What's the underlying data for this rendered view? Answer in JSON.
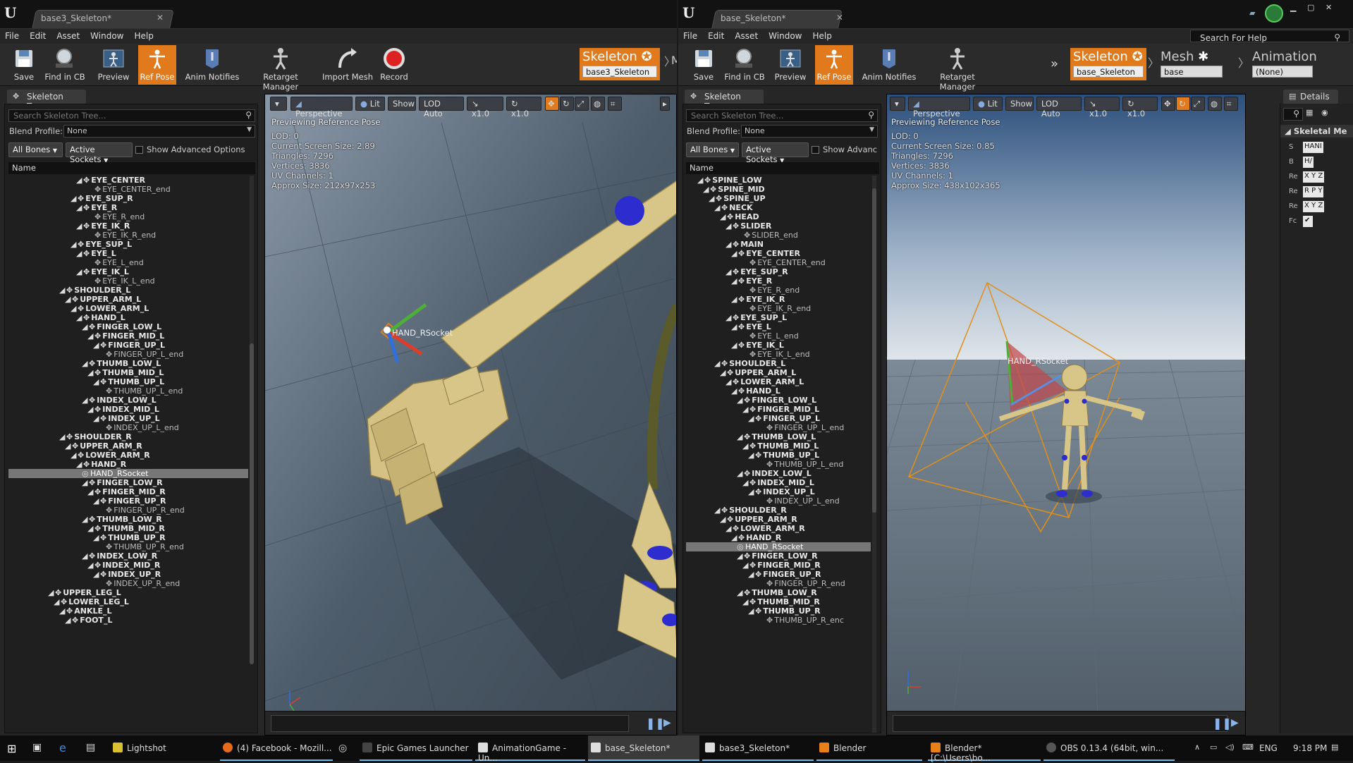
{
  "left": {
    "tab_title": "base3_Skeleton*",
    "menu": [
      "File",
      "Edit",
      "Asset",
      "Window",
      "Help"
    ],
    "toolbar": [
      "Save",
      "Find in CB",
      "Preview",
      "Ref Pose",
      "Anim Notifies",
      "Retarget Manager",
      "Import Mesh",
      "Record"
    ],
    "nav": {
      "skeleton_label": "Skeleton",
      "skeleton_value": "base3_Skeleton",
      "more": "M"
    },
    "tree_tab": "Skeleton Tree",
    "search_placeholder": "Search Skeleton Tree...",
    "blend_profile_label": "Blend Profile:",
    "blend_profile_value": "None",
    "all_bones": "All Bones",
    "active_sockets": "Active Sockets",
    "advanced_label": "Show Advanced Options",
    "name_header": "Name",
    "nodes": [
      {
        "d": 5,
        "t": "EYE_CENTER",
        "b": 1
      },
      {
        "d": 7,
        "t": "EYE_CENTER_end",
        "e": 1
      },
      {
        "d": 4,
        "t": "EYE_SUP_R",
        "b": 1
      },
      {
        "d": 5,
        "t": "EYE_R",
        "b": 1
      },
      {
        "d": 7,
        "t": "EYE_R_end",
        "e": 1
      },
      {
        "d": 5,
        "t": "EYE_IK_R",
        "b": 1
      },
      {
        "d": 7,
        "t": "EYE_IK_R_end",
        "e": 1
      },
      {
        "d": 4,
        "t": "EYE_SUP_L",
        "b": 1
      },
      {
        "d": 5,
        "t": "EYE_L",
        "b": 1
      },
      {
        "d": 7,
        "t": "EYE_L_end",
        "e": 1
      },
      {
        "d": 5,
        "t": "EYE_IK_L",
        "b": 1
      },
      {
        "d": 7,
        "t": "EYE_IK_L_end",
        "e": 1
      },
      {
        "d": 2,
        "t": "SHOULDER_L",
        "b": 1
      },
      {
        "d": 3,
        "t": "UPPER_ARM_L",
        "b": 1
      },
      {
        "d": 4,
        "t": "LOWER_ARM_L",
        "b": 1
      },
      {
        "d": 5,
        "t": "HAND_L",
        "b": 1
      },
      {
        "d": 6,
        "t": "FINGER_LOW_L",
        "b": 1
      },
      {
        "d": 7,
        "t": "FINGER_MID_L",
        "b": 1
      },
      {
        "d": 8,
        "t": "FINGER_UP_L",
        "b": 1
      },
      {
        "d": 9,
        "t": "FINGER_UP_L_end",
        "e": 1
      },
      {
        "d": 6,
        "t": "THUMB_LOW_L",
        "b": 1
      },
      {
        "d": 7,
        "t": "THUMB_MID_L",
        "b": 1
      },
      {
        "d": 8,
        "t": "THUMB_UP_L",
        "b": 1
      },
      {
        "d": 9,
        "t": "THUMB_UP_L_end",
        "e": 1
      },
      {
        "d": 6,
        "t": "INDEX_LOW_L",
        "b": 1
      },
      {
        "d": 7,
        "t": "INDEX_MID_L",
        "b": 1
      },
      {
        "d": 8,
        "t": "INDEX_UP_L",
        "b": 1
      },
      {
        "d": 9,
        "t": "INDEX_UP_L_end",
        "e": 1
      },
      {
        "d": 2,
        "t": "SHOULDER_R",
        "b": 1
      },
      {
        "d": 3,
        "t": "UPPER_ARM_R",
        "b": 1
      },
      {
        "d": 4,
        "t": "LOWER_ARM_R",
        "b": 1
      },
      {
        "d": 5,
        "t": "HAND_R",
        "b": 1
      },
      {
        "d": 6,
        "t": "HAND_RSocket",
        "s": 1,
        "e": 1
      },
      {
        "d": 6,
        "t": "FINGER_LOW_R",
        "b": 1
      },
      {
        "d": 7,
        "t": "FINGER_MID_R",
        "b": 1
      },
      {
        "d": 8,
        "t": "FINGER_UP_R",
        "b": 1
      },
      {
        "d": 9,
        "t": "FINGER_UP_R_end",
        "e": 1
      },
      {
        "d": 6,
        "t": "THUMB_LOW_R",
        "b": 1
      },
      {
        "d": 7,
        "t": "THUMB_MID_R",
        "b": 1
      },
      {
        "d": 8,
        "t": "THUMB_UP_R",
        "b": 1
      },
      {
        "d": 9,
        "t": "THUMB_UP_R_end",
        "e": 1
      },
      {
        "d": 6,
        "t": "INDEX_LOW_R",
        "b": 1
      },
      {
        "d": 7,
        "t": "INDEX_MID_R",
        "b": 1
      },
      {
        "d": 8,
        "t": "INDEX_UP_R",
        "b": 1
      },
      {
        "d": 9,
        "t": "INDEX_UP_R_end",
        "e": 1
      },
      {
        "d": 0,
        "t": "UPPER_LEG_L",
        "b": 1
      },
      {
        "d": 1,
        "t": "LOWER_LEG_L",
        "b": 1
      },
      {
        "d": 2,
        "t": "ANKLE_L",
        "b": 1
      },
      {
        "d": 3,
        "t": "FOOT_L",
        "b": 1
      }
    ],
    "vp": {
      "perspective": "Perspective",
      "lit": "Lit",
      "show": "Show",
      "lod": "LOD Auto",
      "speed1": "x1.0",
      "speed2": "x1.0",
      "title": "Previewing Reference Pose",
      "info": [
        "LOD: 0",
        "Current Screen Size: 2.89",
        "Triangles: 7296",
        "Vertices: 3836",
        "UV Channels: 1",
        "Approx Size: 212x97x253"
      ],
      "socket_label": "HAND_RSocket"
    }
  },
  "right": {
    "tab_title": "base_Skeleton*",
    "menu": [
      "File",
      "Edit",
      "Asset",
      "Window",
      "Help"
    ],
    "help_placeholder": "Search For Help",
    "toolbar": [
      "Save",
      "Find in CB",
      "Preview",
      "Ref Pose",
      "Anim Notifies",
      "Retarget Manager"
    ],
    "nav": {
      "skeleton_label": "Skeleton",
      "skeleton_value": "base_Skeleton",
      "mesh_label": "Mesh",
      "mesh_value": "base",
      "anim_label": "Animation",
      "anim_value": "(None)"
    },
    "tree_tab": "Skeleton Tree",
    "search_placeholder": "Search Skeleton Tree...",
    "blend_profile_label": "Blend Profile:",
    "blend_profile_value": "None",
    "all_bones": "All Bones",
    "active_sockets": "Active Sockets",
    "advanced_label": "Show Advanc",
    "name_header": "Name",
    "nodes": [
      {
        "d": 0,
        "t": "SPINE_LOW",
        "b": 1
      },
      {
        "d": 1,
        "t": "SPINE_MID",
        "b": 1
      },
      {
        "d": 2,
        "t": "SPINE_UP",
        "b": 1
      },
      {
        "d": 3,
        "t": "NECK",
        "b": 1
      },
      {
        "d": 4,
        "t": "HEAD",
        "b": 1
      },
      {
        "d": 5,
        "t": "SLIDER",
        "b": 1
      },
      {
        "d": 7,
        "t": "SLIDER_end",
        "e": 1
      },
      {
        "d": 5,
        "t": "MAIN",
        "b": 1
      },
      {
        "d": 6,
        "t": "EYE_CENTER",
        "b": 1
      },
      {
        "d": 8,
        "t": "EYE_CENTER_end",
        "e": 1
      },
      {
        "d": 5,
        "t": "EYE_SUP_R",
        "b": 1
      },
      {
        "d": 6,
        "t": "EYE_R",
        "b": 1
      },
      {
        "d": 8,
        "t": "EYE_R_end",
        "e": 1
      },
      {
        "d": 6,
        "t": "EYE_IK_R",
        "b": 1
      },
      {
        "d": 8,
        "t": "EYE_IK_R_end",
        "e": 1
      },
      {
        "d": 5,
        "t": "EYE_SUP_L",
        "b": 1
      },
      {
        "d": 6,
        "t": "EYE_L",
        "b": 1
      },
      {
        "d": 8,
        "t": "EYE_L_end",
        "e": 1
      },
      {
        "d": 6,
        "t": "EYE_IK_L",
        "b": 1
      },
      {
        "d": 8,
        "t": "EYE_IK_L_end",
        "e": 1
      },
      {
        "d": 3,
        "t": "SHOULDER_L",
        "b": 1
      },
      {
        "d": 4,
        "t": "UPPER_ARM_L",
        "b": 1
      },
      {
        "d": 5,
        "t": "LOWER_ARM_L",
        "b": 1
      },
      {
        "d": 6,
        "t": "HAND_L",
        "b": 1
      },
      {
        "d": 7,
        "t": "FINGER_LOW_L",
        "b": 1
      },
      {
        "d": 8,
        "t": "FINGER_MID_L",
        "b": 1
      },
      {
        "d": 9,
        "t": "FINGER_UP_L",
        "b": 1
      },
      {
        "d": 11,
        "t": "FINGER_UP_L_end",
        "e": 1
      },
      {
        "d": 7,
        "t": "THUMB_LOW_L",
        "b": 1
      },
      {
        "d": 8,
        "t": "THUMB_MID_L",
        "b": 1
      },
      {
        "d": 9,
        "t": "THUMB_UP_L",
        "b": 1
      },
      {
        "d": 11,
        "t": "THUMB_UP_L_end",
        "e": 1
      },
      {
        "d": 7,
        "t": "INDEX_LOW_L",
        "b": 1
      },
      {
        "d": 8,
        "t": "INDEX_MID_L",
        "b": 1
      },
      {
        "d": 9,
        "t": "INDEX_UP_L",
        "b": 1
      },
      {
        "d": 11,
        "t": "INDEX_UP_L_end",
        "e": 1
      },
      {
        "d": 3,
        "t": "SHOULDER_R",
        "b": 1
      },
      {
        "d": 4,
        "t": "UPPER_ARM_R",
        "b": 1
      },
      {
        "d": 5,
        "t": "LOWER_ARM_R",
        "b": 1
      },
      {
        "d": 6,
        "t": "HAND_R",
        "b": 1
      },
      {
        "d": 7,
        "t": "HAND_RSocket",
        "s": 1,
        "e": 1
      },
      {
        "d": 7,
        "t": "FINGER_LOW_R",
        "b": 1
      },
      {
        "d": 8,
        "t": "FINGER_MID_R",
        "b": 1
      },
      {
        "d": 9,
        "t": "FINGER_UP_R",
        "b": 1
      },
      {
        "d": 11,
        "t": "FINGER_UP_R_end",
        "e": 1
      },
      {
        "d": 7,
        "t": "THUMB_LOW_R",
        "b": 1
      },
      {
        "d": 8,
        "t": "THUMB_MID_R",
        "b": 1
      },
      {
        "d": 9,
        "t": "THUMB_UP_R",
        "b": 1
      },
      {
        "d": 11,
        "t": "THUMB_UP_R_enc",
        "e": 1
      }
    ],
    "vp": {
      "perspective": "Perspective",
      "lit": "Lit",
      "show": "Show",
      "lod": "LOD Auto",
      "speed1": "x1.0",
      "speed2": "x1.0",
      "title": "Previewing Reference Pose",
      "info": [
        "LOD: 0",
        "Current Screen Size: 0.85",
        "Triangles: 7296",
        "Vertices: 3836",
        "UV Channels: 1",
        "Approx Size: 438x102x365"
      ],
      "socket_label": "HAND_RSocket"
    },
    "details": {
      "tab": "Details",
      "section": "Skeletal Me",
      "rows": [
        {
          "k": "S",
          "v": "HANI"
        },
        {
          "k": "B",
          "v": "H/"
        },
        {
          "k": "Re",
          "v": "X Y Z"
        },
        {
          "k": "Re",
          "v": "R P Y"
        },
        {
          "k": "Re",
          "v": "X Y Z"
        },
        {
          "k": "Fc",
          "v": ""
        }
      ]
    }
  },
  "taskbar": {
    "items": [
      "Lightshot",
      "(4) Facebook - Mozill...",
      "Epic Games Launcher",
      "AnimationGame - Un...",
      "base_Skeleton*",
      "base3_Skeleton*",
      "Blender",
      "Blender* [C:\\Users\\bo...",
      "OBS 0.13.4 (64bit, win..."
    ],
    "lang": "ENG",
    "time": "9:18 PM"
  },
  "colors": {
    "accent": "#e07a1d",
    "selection": "#777777",
    "axis_x": "#e03c2a",
    "axis_y": "#4caf38",
    "axis_z": "#2f6fe0"
  }
}
